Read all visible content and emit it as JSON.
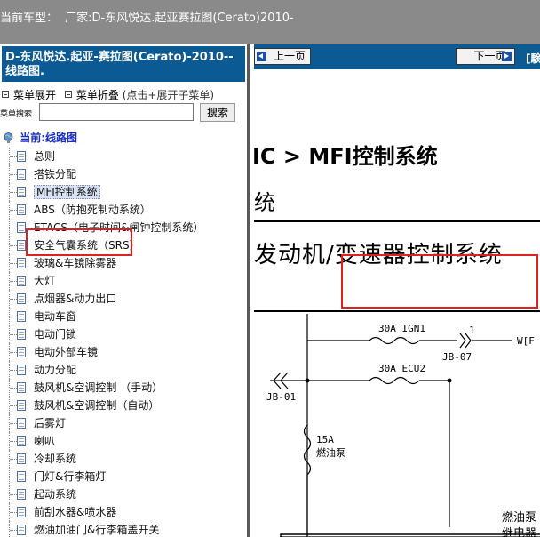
{
  "header": {
    "vehicle_label": "当前车型：",
    "vehicle_value": "厂家:D-东风悦达.起亚赛拉图(Cerato)2010-"
  },
  "left_panel": {
    "title": "D-东风悦达.起亚-赛拉图(Cerato)-2010-- 线路图.",
    "menu_expand": "菜单展开",
    "menu_collapse": "菜单折叠",
    "menu_hint": "(点击+展开子菜单)",
    "search_label": "菜单搜索",
    "search_value": "",
    "search_button": "搜索",
    "tree_root": "当前:线路图",
    "tree_items": [
      "总则",
      "搭铁分配",
      "MFI控制系统",
      "ABS（防抱死制动系统）",
      "ETACS（电子时间&闸钟控制系统）",
      "安全气囊系统（SRS）",
      "玻璃&车镜除雾器",
      "大灯",
      "点烟器&动力出口",
      "电动车窗",
      "电动门锁",
      "电动外部车镜",
      "动力分配",
      "鼓风机&空调控制 （手动）",
      "鼓风机&空调控制（自动）",
      "后雾灯",
      "喇叭",
      "冷却系统",
      "门灯&行李箱灯",
      "起动系统",
      "前刮水器&喷水器",
      "燃油加油门&行李箱盖开关"
    ],
    "selected_index": 2
  },
  "right_panel": {
    "prev_button": "上一页",
    "next_button": "下一页",
    "nav_extra": "[験",
    "breadcrumb": "IC > MFI控制系统",
    "subtitle": "统",
    "heading_prefix": "发动机/",
    "heading_highlight": "变速器控制系统",
    "schematic": {
      "fuse1": "30A IGN1",
      "fuse2": "30A ECU2",
      "connector_top": "JB-07",
      "connector_left": "JB-01",
      "pin": "1",
      "wire_label": "W[F",
      "fuse3_rating": "15A",
      "fuse3_name": "燃油泵",
      "relay_label_1": "燃油泵",
      "relay_label_2": "继电器"
    }
  },
  "colors": {
    "top_bar": "#8a8a8a",
    "panel_title": "#0b5a94",
    "highlight_box": "#e02020",
    "tree_root": "#1a2fc8"
  }
}
